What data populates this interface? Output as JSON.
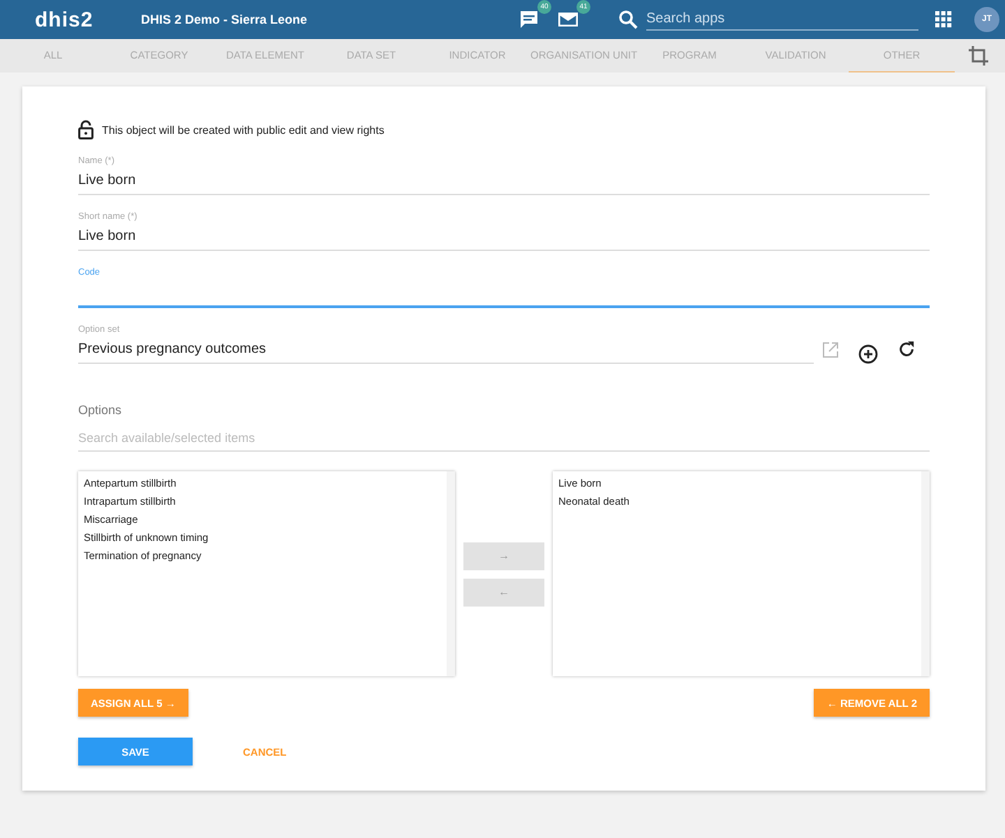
{
  "header": {
    "logo": "dhis2",
    "title": "DHIS 2 Demo - Sierra Leone",
    "messages_badge": "40",
    "mail_badge": "41",
    "search": {
      "placeholder": "Search apps"
    },
    "avatar": "JT"
  },
  "tabs": [
    {
      "label": "ALL",
      "selected": false
    },
    {
      "label": "CATEGORY",
      "selected": false
    },
    {
      "label": "DATA ELEMENT",
      "selected": false
    },
    {
      "label": "DATA SET",
      "selected": false
    },
    {
      "label": "INDICATOR",
      "selected": false
    },
    {
      "label": "ORGANISATION UNIT",
      "selected": false
    },
    {
      "label": "PROGRAM",
      "selected": false
    },
    {
      "label": "VALIDATION",
      "selected": false
    },
    {
      "label": "OTHER",
      "selected": true
    }
  ],
  "notice": "This object will be created with public edit and view rights",
  "fields": [
    {
      "label": "Name (*)",
      "value": "Live born",
      "focused": false
    },
    {
      "label": "Short name (*)",
      "value": "Live born",
      "focused": false
    },
    {
      "label": "Code",
      "focused": true
    }
  ],
  "option_set": {
    "label": "Option set",
    "value": "Previous pregnancy outcomes"
  },
  "options": {
    "title": "Options",
    "search": {
      "placeholder": "Search available/selected items"
    },
    "available": [
      "Antepartum stillbirth",
      "Intrapartum stillbirth",
      "Miscarriage",
      "Stillbirth of unknown timing",
      "Termination of pregnancy"
    ],
    "selected": [
      "Live born",
      "Neonatal death"
    ],
    "assign_arrow": "→",
    "remove_arrow": "←",
    "assign_all": "ASSIGN ALL 5 →",
    "remove_all": "← REMOVE ALL 2"
  },
  "buttons": {
    "save": "SAVE",
    "cancel": "CANCEL"
  }
}
